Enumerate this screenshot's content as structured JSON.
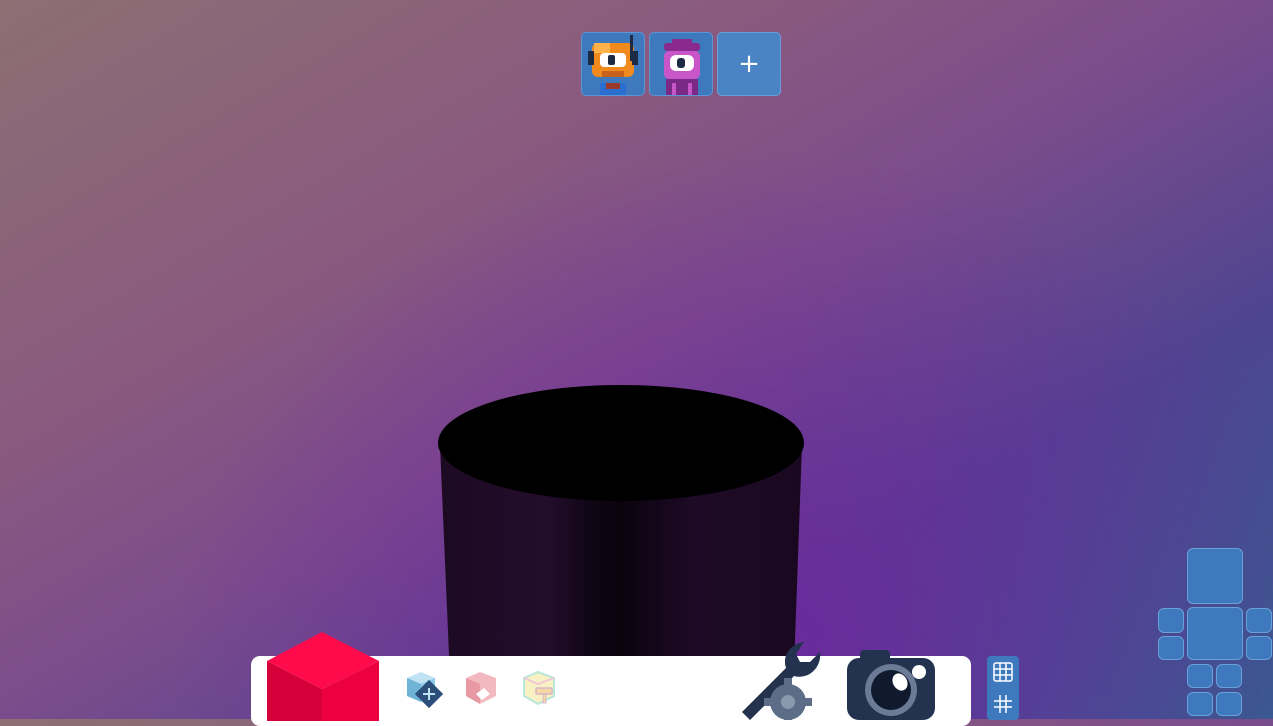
{
  "characters": [
    {
      "icon": "orange-robot-icon",
      "color": "#f08a1c"
    },
    {
      "icon": "purple-cyclops-icon",
      "color": "#c856c8"
    }
  ],
  "add_character": {
    "label": "+"
  },
  "tools": [
    {
      "icon": "block-move-icon"
    },
    {
      "icon": "block-erase-icon"
    },
    {
      "icon": "block-paint-icon"
    }
  ],
  "selected_block": {
    "icon": "red-cube-icon",
    "color": "#e8003d"
  },
  "settings": {
    "icon": "wrench-gear-icon"
  },
  "camera": {
    "icon": "camera-icon"
  },
  "grid_toggles": [
    {
      "icon": "grid-icon"
    },
    {
      "icon": "hash-grid-icon"
    }
  ],
  "colors": {
    "panel_blue": "#3f79bd",
    "toolbar_bg": "#ffffff",
    "cube_red": "#e8003d"
  }
}
